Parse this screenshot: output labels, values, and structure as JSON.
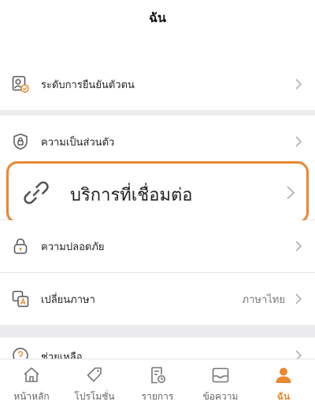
{
  "header": {
    "title": "ฉัน"
  },
  "menu": {
    "verification": {
      "label": "ระดับการยืนยันตัวตน",
      "icon": "id-verified-icon"
    },
    "privacy": {
      "label": "ความเป็นส่วนตัว",
      "icon": "shield-lock-icon"
    },
    "connected_services": {
      "label": "บริการที่เชื่อมต่อ",
      "icon": "link-icon"
    },
    "security": {
      "label": "ความปลอดภัย",
      "icon": "padlock-icon"
    },
    "language": {
      "label": "เปลี่ยนภาษา",
      "value": "ภาษาไทย",
      "icon": "translate-icon"
    },
    "help": {
      "label": "ช่วยเหลือ",
      "icon": "help-icon"
    }
  },
  "tabs": [
    {
      "label": "หน้าหลัก",
      "icon": "home-icon"
    },
    {
      "label": "โปรโมชั่น",
      "icon": "tag-icon"
    },
    {
      "label": "รายการ",
      "icon": "receipt-icon"
    },
    {
      "label": "ข้อความ",
      "icon": "inbox-icon"
    },
    {
      "label": "ฉัน",
      "icon": "user-icon",
      "active": true
    }
  ],
  "colors": {
    "accent": "#e8892f",
    "icon": "#555555",
    "chevron": "#b0b0b0"
  }
}
